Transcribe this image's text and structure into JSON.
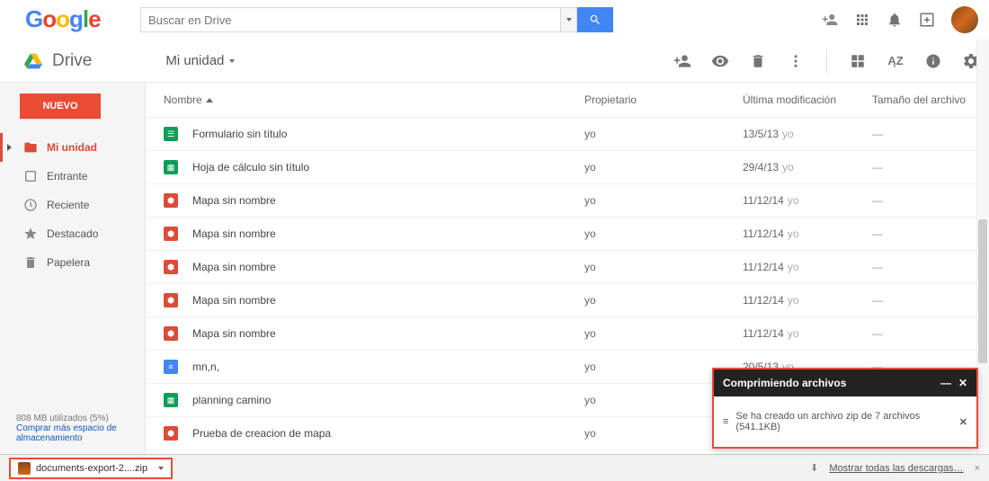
{
  "search": {
    "placeholder": "Buscar en Drive"
  },
  "drive_label": "Drive",
  "breadcrumb": "Mi unidad",
  "new_button": "NUEVO",
  "sidebar": {
    "items": [
      {
        "label": "Mi unidad",
        "icon": "folder",
        "active": true
      },
      {
        "label": "Entrante",
        "icon": "incoming",
        "active": false
      },
      {
        "label": "Reciente",
        "icon": "recent",
        "active": false
      },
      {
        "label": "Destacado",
        "icon": "star",
        "active": false
      },
      {
        "label": "Papelera",
        "icon": "trash",
        "active": false
      }
    ]
  },
  "storage": {
    "usage_text": "808 MB utilizados (5%)",
    "link1": "Comprar más espacio de",
    "link2": "almacenamiento"
  },
  "columns": {
    "name": "Nombre",
    "owner": "Propietario",
    "modified": "Última modificación",
    "size": "Tamaño del archivo"
  },
  "files": [
    {
      "icon": "form",
      "name": "Formulario sin título",
      "owner": "yo",
      "modified": "13/5/13",
      "by": "yo",
      "size": "—"
    },
    {
      "icon": "sheet",
      "name": "Hoja de cálculo sin título",
      "owner": "yo",
      "modified": "29/4/13",
      "by": "yo",
      "size": "—"
    },
    {
      "icon": "map",
      "name": "Mapa sin nombre",
      "owner": "yo",
      "modified": "11/12/14",
      "by": "yo",
      "size": "—"
    },
    {
      "icon": "map",
      "name": "Mapa sin nombre",
      "owner": "yo",
      "modified": "11/12/14",
      "by": "yo",
      "size": "—"
    },
    {
      "icon": "map",
      "name": "Mapa sin nombre",
      "owner": "yo",
      "modified": "11/12/14",
      "by": "yo",
      "size": "—"
    },
    {
      "icon": "map",
      "name": "Mapa sin nombre",
      "owner": "yo",
      "modified": "11/12/14",
      "by": "yo",
      "size": "—"
    },
    {
      "icon": "map",
      "name": "Mapa sin nombre",
      "owner": "yo",
      "modified": "11/12/14",
      "by": "yo",
      "size": "—"
    },
    {
      "icon": "doc",
      "name": "mn,n,",
      "owner": "yo",
      "modified": "20/5/13",
      "by": "yo",
      "size": "—"
    },
    {
      "icon": "sheet",
      "name": "planning camino",
      "owner": "yo",
      "modified": "",
      "by": "",
      "size": ""
    },
    {
      "icon": "map",
      "name": "Prueba de creacion de mapa",
      "owner": "yo",
      "modified": "",
      "by": "",
      "size": ""
    }
  ],
  "compress": {
    "title": "Comprimiendo archivos",
    "message": "Se ha creado un archivo zip de 7 archivos (541.1KB)"
  },
  "download_bar": {
    "file": "documents-export-2....zip",
    "show_all": "Mostrar todas las descargas…"
  }
}
